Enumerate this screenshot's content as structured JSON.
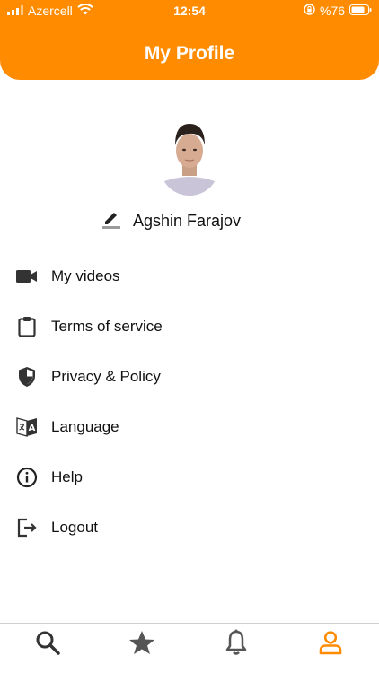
{
  "status_bar": {
    "carrier": "Azercell",
    "time": "12:54",
    "battery": "%76"
  },
  "header": {
    "title": "My Profile"
  },
  "profile": {
    "name": "Agshin Farajov"
  },
  "menu": [
    {
      "label": "My videos",
      "icon": "video-camera-icon"
    },
    {
      "label": "Terms of service",
      "icon": "clipboard-icon"
    },
    {
      "label": "Privacy & Policy",
      "icon": "shield-icon"
    },
    {
      "label": "Language",
      "icon": "translate-icon"
    },
    {
      "label": "Help",
      "icon": "info-icon"
    },
    {
      "label": "Logout",
      "icon": "logout-icon"
    }
  ],
  "tabs": [
    {
      "icon": "search-icon"
    },
    {
      "icon": "star-icon"
    },
    {
      "icon": "bell-icon"
    },
    {
      "icon": "user-icon",
      "active": true
    }
  ],
  "colors": {
    "accent": "#FF8C00",
    "text": "#111111",
    "icon": "#333333"
  }
}
